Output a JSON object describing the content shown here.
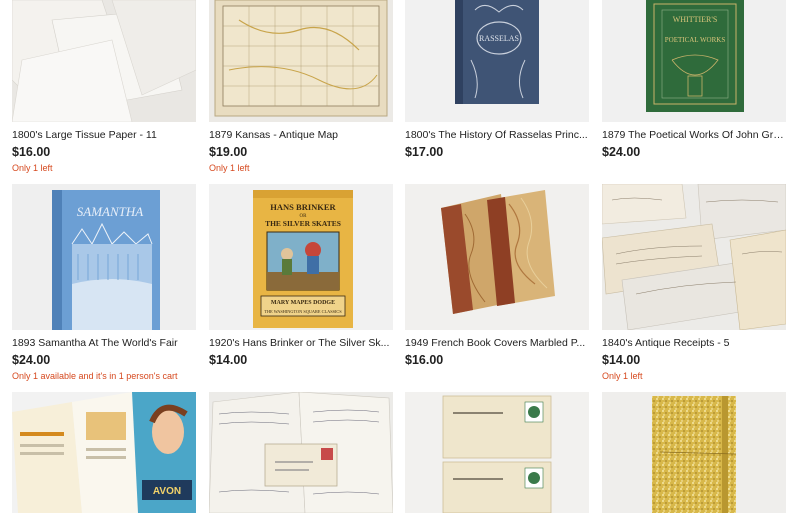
{
  "listings": [
    {
      "title": "1800's Large Tissue Paper - 11",
      "price": "$16.00",
      "stock": "Only 1 left",
      "image": "tissue-paper-image"
    },
    {
      "title": "1879 Kansas - Antique Map",
      "price": "$19.00",
      "stock": "Only 1 left",
      "image": "kansas-map-image"
    },
    {
      "title": "1800's The History Of Rasselas Princ...",
      "price": "$17.00",
      "stock": "",
      "image": "rasselas-book-image",
      "cover_text": "RASSELAS"
    },
    {
      "title": "1879 The Poetical Works Of John Gre...",
      "price": "$24.00",
      "stock": "",
      "image": "poetical-works-book-image",
      "cover_text_1": "WHITTIER'S",
      "cover_text_2": "POETICAL WORKS"
    },
    {
      "title": "1893 Samantha At The World's Fair",
      "price": "$24.00",
      "stock": "Only 1 available and it's in 1 person's cart",
      "image": "samantha-book-image",
      "cover_text": "SAMANTHA"
    },
    {
      "title": "1920's Hans Brinker or The Silver Sk...",
      "price": "$14.00",
      "stock": "",
      "image": "hans-brinker-book-image",
      "cover_text_1": "HANS BRINKER",
      "cover_text_2": "OR",
      "cover_text_3": "THE SILVER SKATES",
      "cover_text_4": "MARY MAPES DODGE",
      "cover_text_5": "THE WASHINGTON SQUARE CLASSICS"
    },
    {
      "title": "1949 French Book Covers Marbled P...",
      "price": "$16.00",
      "stock": "",
      "image": "marbled-covers-image"
    },
    {
      "title": "1840's Antique Receipts - 5",
      "price": "$14.00",
      "stock": "Only 1 left",
      "image": "antique-receipts-image"
    },
    {
      "title": "",
      "price": "",
      "stock": "",
      "image": "avon-brochure-image",
      "cover_text": "AVON"
    },
    {
      "title": "",
      "price": "",
      "stock": "",
      "image": "handwritten-letters-image"
    },
    {
      "title": "",
      "price": "",
      "stock": "",
      "image": "postcards-image"
    },
    {
      "title": "",
      "price": "",
      "stock": "",
      "image": "gold-glitter-journal-image"
    }
  ],
  "colors": {
    "stock": "#d6491f",
    "text": "#222222"
  }
}
